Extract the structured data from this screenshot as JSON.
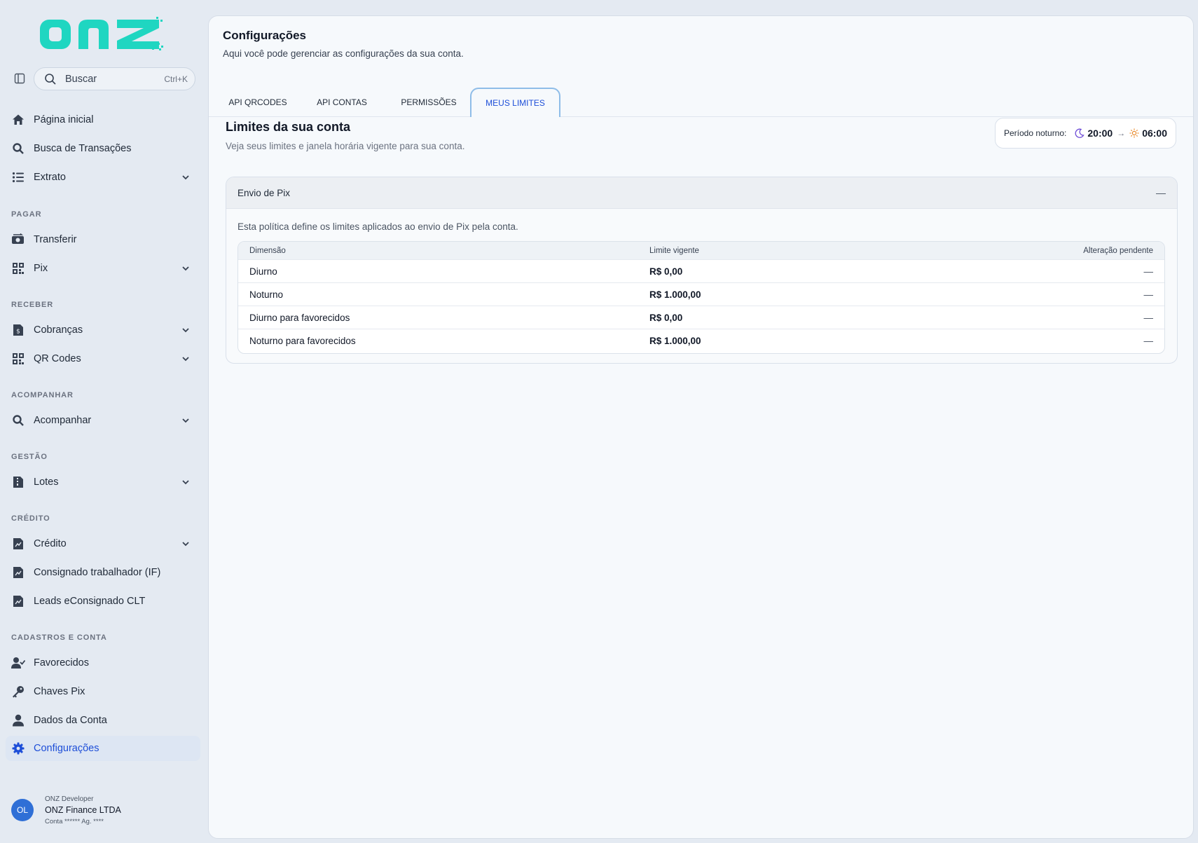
{
  "brand": {
    "logo_text": "onz",
    "accent_color": "#1fd6c1",
    "primary_color": "#1d4ed8"
  },
  "search": {
    "label": "Buscar",
    "shortcut": "Ctrl+K"
  },
  "sidebar": {
    "items": [
      {
        "label": "Página inicial",
        "icon": "home-icon"
      },
      {
        "label": "Busca de Transações",
        "icon": "search-icon"
      },
      {
        "label": "Extrato",
        "icon": "list-icon",
        "expandable": true
      }
    ],
    "sections": [
      {
        "title": "PAGAR",
        "items": [
          {
            "label": "Transferir",
            "icon": "money-transfer-icon"
          },
          {
            "label": "Pix",
            "icon": "qr-grid-icon",
            "expandable": true
          }
        ]
      },
      {
        "title": "RECEBER",
        "items": [
          {
            "label": "Cobranças",
            "icon": "invoice-icon",
            "expandable": true
          },
          {
            "label": "QR Codes",
            "icon": "qr-grid-icon",
            "expandable": true
          }
        ]
      },
      {
        "title": "ACOMPANHAR",
        "items": [
          {
            "label": "Acompanhar",
            "icon": "search-icon",
            "expandable": true
          }
        ]
      },
      {
        "title": "GESTÃO",
        "items": [
          {
            "label": "Lotes",
            "icon": "file-zip-icon",
            "expandable": true
          }
        ]
      },
      {
        "title": "CRÉDITO",
        "items": [
          {
            "label": "Crédito",
            "icon": "file-chart-icon",
            "expandable": true
          },
          {
            "label": "Consignado trabalhador (IF)",
            "icon": "file-chart-icon"
          },
          {
            "label": "Leads eConsignado CLT",
            "icon": "file-chart-icon"
          }
        ]
      },
      {
        "title": "CADASTROS E CONTA",
        "items": [
          {
            "label": "Favorecidos",
            "icon": "user-check-icon"
          },
          {
            "label": "Chaves Pix",
            "icon": "key-icon"
          },
          {
            "label": "Dados da Conta",
            "icon": "user-icon"
          },
          {
            "label": "Configurações",
            "icon": "gear-icon",
            "active": true
          }
        ]
      }
    ]
  },
  "user": {
    "initials": "OL",
    "role": "ONZ Developer",
    "company": "ONZ Finance LTDA",
    "account": "Conta ****** Ag. ****"
  },
  "page": {
    "title": "Configurações",
    "subtitle": "Aqui você pode gerenciar as configurações da sua conta."
  },
  "tabs": [
    {
      "label": "API QRCODES"
    },
    {
      "label": "API CONTAS"
    },
    {
      "label": "PERMISSÕES"
    },
    {
      "label": "MEUS LIMITES",
      "active": true
    }
  ],
  "limits": {
    "title": "Limites da sua conta",
    "subtitle": "Veja seus limites e janela horária vigente para sua conta.",
    "night_period": {
      "label": "Período noturno:",
      "start": "20:00",
      "arrow": "→",
      "end": "06:00"
    },
    "accordion": {
      "title": "Envio de Pix",
      "collapse_symbol": "—",
      "description": "Esta política define os limites aplicados ao envio de Pix pela conta.",
      "table": {
        "headers": [
          "Dimensão",
          "Limite vigente",
          "Alteração pendente"
        ],
        "rows": [
          [
            "Diurno",
            "R$ 0,00",
            "—"
          ],
          [
            "Noturno",
            "R$ 1.000,00",
            "—"
          ],
          [
            "Diurno para favorecidos",
            "R$ 0,00",
            "—"
          ],
          [
            "Noturno para favorecidos",
            "R$ 1.000,00",
            "—"
          ]
        ]
      }
    }
  }
}
